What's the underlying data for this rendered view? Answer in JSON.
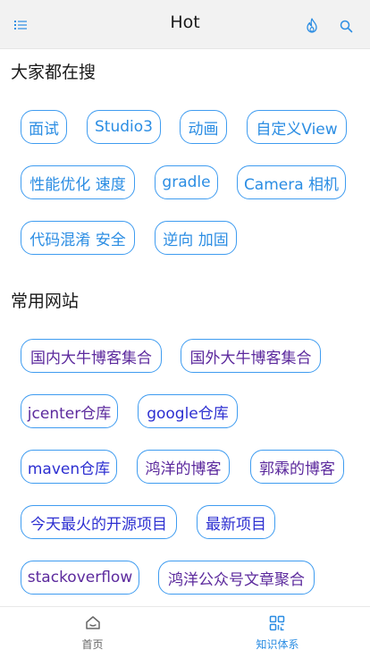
{
  "appbar": {
    "title": "Hot",
    "menu_icon": "list-icon",
    "hot_icon": "flame-icon",
    "search_icon": "search-icon"
  },
  "sections": [
    {
      "title": "大家都在搜",
      "chips": [
        "面试",
        "Studio3",
        "动画",
        "自定义View",
        "性能优化 速度",
        "gradle",
        "Camera 相机",
        "代码混淆 安全",
        "逆向 加固"
      ]
    },
    {
      "title": "常用网站",
      "chips": [
        "国内大牛博客集合",
        "国外大牛博客集合",
        "jcenter仓库",
        "google仓库",
        "maven仓库",
        "鸿洋的博客",
        "郭霖的博客",
        "今天最火的开源项目",
        "最新项目",
        "stackoverflow",
        "鸿洋公众号文章聚合"
      ]
    }
  ],
  "bottom_nav": [
    {
      "label": "首页",
      "icon": "home-icon",
      "active": false
    },
    {
      "label": "知识体系",
      "icon": "grid-icon",
      "active": true
    }
  ],
  "colors": {
    "accent": "#2b8de3",
    "chip_border": "#3f9cf0",
    "visited_link": "#5c2a9d",
    "link": "#2d2fd1",
    "inactive_nav": "#666666"
  }
}
